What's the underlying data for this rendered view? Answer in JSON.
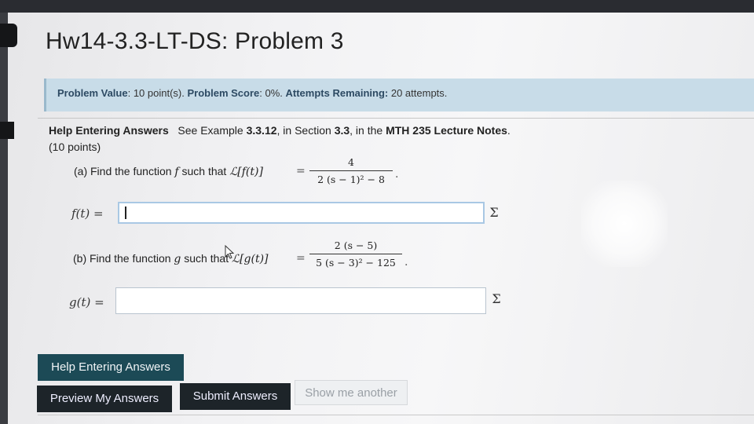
{
  "header": {
    "title": "Hw14-3.3-LT-DS: Problem 3"
  },
  "info": {
    "value_label": "Problem Value",
    "value": ": 10 point(s).",
    "score_label": "Problem Score",
    "score": ": 0%.",
    "attempts_label": "Attempts Remaining:",
    "attempts": "20 attempts."
  },
  "help": {
    "link": "Help Entering Answers",
    "see": "See Example",
    "example": "3.3.12",
    "in_section": ", in Section",
    "section": "3.3",
    "in_the": ", in the",
    "notes": "MTH 235 Lecture Notes",
    "period": "."
  },
  "points": "(10 points)",
  "part_a": {
    "prefix": "(a) Find the function",
    "var": "f",
    "such_that": "such that",
    "transform": "ℒ[f(t)]",
    "eq": "=",
    "numerator": "4",
    "denominator": "2 (s − 1)² − 8",
    "dot": ".",
    "answer_label": "f(t) =",
    "answer_value": ""
  },
  "part_b": {
    "prefix": "(b) Find the function",
    "var": "g",
    "such_that": "such that",
    "transform": "ℒ[g(t)]",
    "eq": "=",
    "numerator": "2 (s − 5)",
    "denominator": "5 (s − 3)² − 125",
    "dot": ".",
    "answer_label": "g(t) =",
    "answer_value": ""
  },
  "sigma_glyph": "Σ",
  "buttons": {
    "help": "Help Entering Answers",
    "preview": "Preview My Answers",
    "submit": "Submit Answers",
    "another": "Show me another"
  },
  "colors": {
    "info_bg": "#c8dce8",
    "help_button": "#1c4a56",
    "dark_button": "#1d2429",
    "label_blue": "#2d4a63"
  }
}
